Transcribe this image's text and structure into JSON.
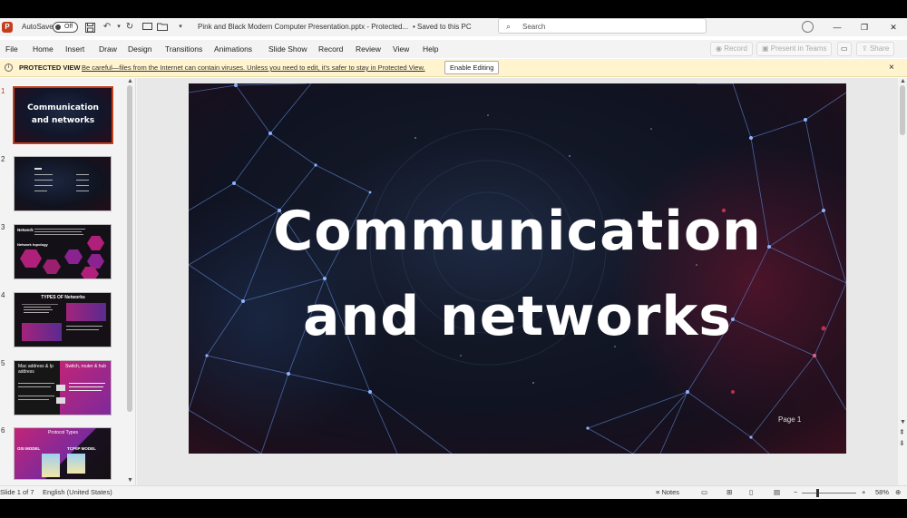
{
  "titlebar": {
    "app_icon": "P",
    "autosave_label": "AutoSave",
    "autosave_state": "Off",
    "doc_title": "Pink and Black Modern Computer Presentation.pptx  -  Protected...",
    "saved_status": "•  Saved to this PC",
    "search_placeholder": "Search",
    "icons": [
      "save-icon",
      "undo-icon",
      "redo-icon",
      "open-folder-icon",
      "customize-icon",
      "user-icon",
      "minimize-icon",
      "restore-icon",
      "close-icon"
    ]
  },
  "ribbon": {
    "tabs": [
      "File",
      "Home",
      "Insert",
      "Draw",
      "Design",
      "Transitions",
      "Animations",
      "Slide Show",
      "Record",
      "Review",
      "View",
      "Help"
    ],
    "record_btn": "Record",
    "present_btn": "Present in Teams",
    "share_btn": "Share"
  },
  "protected_view": {
    "title": "PROTECTED VIEW",
    "message": "Be careful—files from the Internet can contain viruses. Unless you need to edit, it's safer to stay in Protected View.",
    "button": "Enable Editing",
    "close": "×"
  },
  "thumbnails": [
    {
      "num": "1",
      "title": "Communication and networks"
    },
    {
      "num": "2",
      "title": "Menu"
    },
    {
      "num": "3",
      "title": "Network"
    },
    {
      "num": "4",
      "title": "TYPES OF Networks"
    },
    {
      "num": "5",
      "title": "Mac address & Ip address"
    },
    {
      "num": "6",
      "title": "Protocol Types"
    }
  ],
  "thumb_text": {
    "t1_line1": "Communication",
    "t1_line2": "and networks",
    "t3_topology": "Network topology",
    "t4_title": "TYPES OF Networks",
    "t5_left": "Mac address & Ip address",
    "t5_right": "Switch, router & hub",
    "t6_title": "Protocol Types",
    "t6_osi": "OSI MODEL",
    "t6_tcp": "TCP/IP MODEL"
  },
  "slide": {
    "title_line1": "Communication",
    "title_line2": "and networks",
    "page_label": "Page 1",
    "colors": {
      "bg_dark": "#111626",
      "accent_red": "#8a1030",
      "line_blue": "#5a7fc8"
    }
  },
  "status": {
    "slide_info": "Slide 1 of 7",
    "language": "English (United States)",
    "notes": "Notes",
    "zoom": "58%"
  }
}
